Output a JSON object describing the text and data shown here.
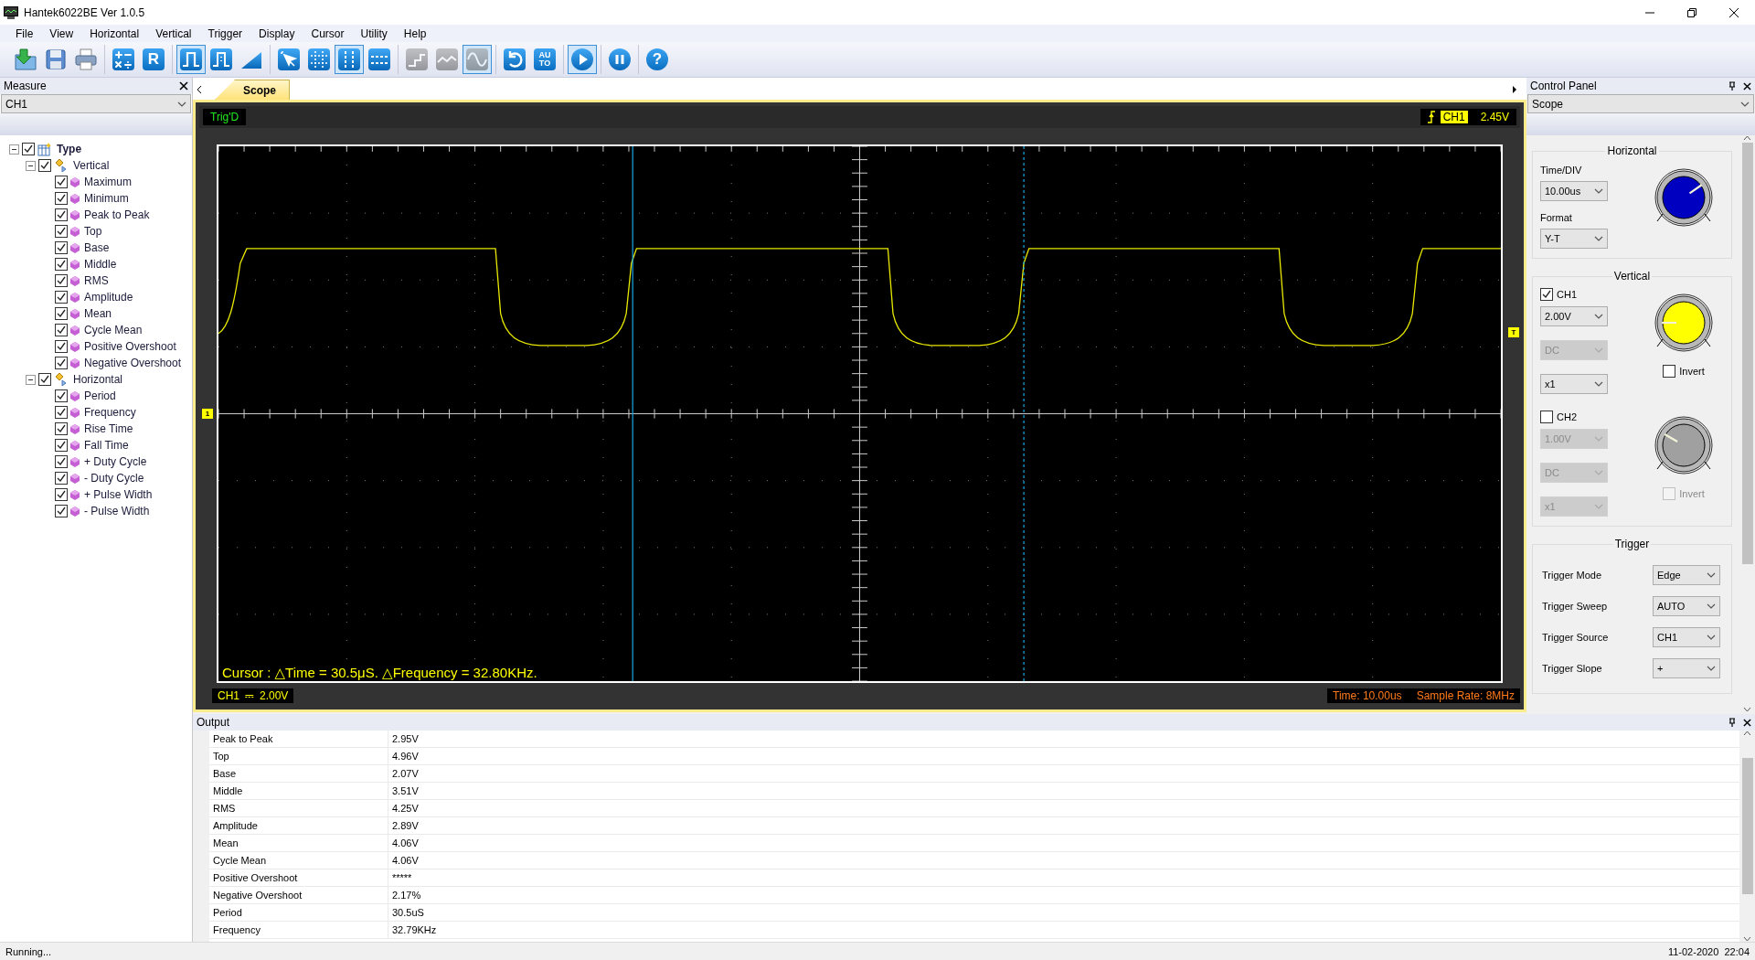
{
  "window": {
    "title": "Hantek6022BE Ver 1.0.5"
  },
  "menu": [
    "File",
    "View",
    "Horizontal",
    "Vertical",
    "Trigger",
    "Display",
    "Cursor",
    "Utility",
    "Help"
  ],
  "toolbar": [
    {
      "buttons": [
        {
          "pressed": false,
          "disabled": false
        },
        {
          "pressed": false,
          "disabled": false
        },
        {
          "pressed": false,
          "disabled": false
        }
      ]
    },
    {
      "buttons": [
        {
          "pressed": false,
          "disabled": false
        },
        {
          "pressed": false,
          "disabled": false,
          "label": "R"
        }
      ]
    },
    {
      "buttons": [
        {
          "pressed": true,
          "disabled": false
        },
        {
          "pressed": false,
          "disabled": false
        },
        {
          "pressed": false,
          "disabled": false
        }
      ]
    },
    {
      "buttons": [
        {
          "pressed": false,
          "disabled": false
        },
        {
          "pressed": false,
          "disabled": false
        },
        {
          "pressed": true,
          "disabled": false
        },
        {
          "pressed": false,
          "disabled": false
        }
      ]
    },
    {
      "buttons": [
        {
          "pressed": false,
          "disabled": true
        },
        {
          "pressed": false,
          "disabled": true
        },
        {
          "pressed": true,
          "disabled": true
        }
      ]
    },
    {
      "buttons": [
        {
          "pressed": false,
          "disabled": false
        },
        {
          "pressed": false,
          "disabled": false,
          "label": "AUTO"
        }
      ]
    },
    {
      "buttons": [
        {
          "pressed": true,
          "disabled": false
        }
      ]
    },
    {
      "buttons": [
        {
          "pressed": false,
          "disabled": false
        }
      ]
    },
    {
      "buttons": [
        {
          "pressed": false,
          "disabled": false,
          "label": "?"
        }
      ]
    }
  ],
  "measure_panel": {
    "title": "Measure",
    "channel": "CH1",
    "tree": [
      {
        "label": "Type",
        "checked": true,
        "expanded": true,
        "children": [
          {
            "label": "Vertical",
            "checked": true,
            "expanded": true,
            "children": [
              {
                "label": "Maximum",
                "checked": true
              },
              {
                "label": "Minimum",
                "checked": true
              },
              {
                "label": "Peak to Peak",
                "checked": true
              },
              {
                "label": "Top",
                "checked": true
              },
              {
                "label": "Base",
                "checked": true
              },
              {
                "label": "Middle",
                "checked": true
              },
              {
                "label": "RMS",
                "checked": true
              },
              {
                "label": "Amplitude",
                "checked": true
              },
              {
                "label": "Mean",
                "checked": true
              },
              {
                "label": "Cycle Mean",
                "checked": true
              },
              {
                "label": "Positive Overshoot",
                "checked": true
              },
              {
                "label": "Negative Overshoot",
                "checked": true
              }
            ]
          },
          {
            "label": "Horizontal",
            "checked": true,
            "expanded": true,
            "children": [
              {
                "label": "Period",
                "checked": true
              },
              {
                "label": "Frequency",
                "checked": true
              },
              {
                "label": "Rise Time",
                "checked": true
              },
              {
                "label": "Fall Time",
                "checked": true
              },
              {
                "label": "+ Duty Cycle",
                "checked": true
              },
              {
                "label": "- Duty Cycle",
                "checked": true
              },
              {
                "label": "+ Pulse Width",
                "checked": true
              },
              {
                "label": "- Pulse Width",
                "checked": true
              }
            ]
          }
        ]
      }
    ]
  },
  "tabs": [
    {
      "label": "Scope",
      "selected": true
    }
  ],
  "scope": {
    "status": "Trig'D",
    "trigger_channel": "CH1",
    "trigger_level": "2.45V",
    "ch1_marker": "1",
    "trigger_marker": "T",
    "cursor_readout": "Cursor : △Time = 30.5μS. △Frequency = 32.80KHz.",
    "channel_label": "CH1",
    "coupling_symbol": "⎓",
    "volts_div": "2.00V",
    "time_div": "Time: 10.00us",
    "sample_rate": "Sample Rate: 8MHz"
  },
  "control_panel": {
    "title": "Control Panel",
    "mode": "Scope",
    "horizontal": {
      "title": "Horizontal",
      "time_label": "Time/DIV",
      "time_div": "10.00us",
      "format_label": "Format",
      "format": "Y-T",
      "color": "#0000c0"
    },
    "vertical": {
      "title": "Vertical",
      "channels": [
        {
          "name": "CH1",
          "checked": true,
          "color": "#ffff00",
          "volts": {
            "value": "2.00V",
            "disabled": false
          },
          "coupling": {
            "value": "DC",
            "disabled": true
          },
          "probe": {
            "value": "x1",
            "disabled": false
          },
          "invert_label": "Invert",
          "inverted": false,
          "invert_disabled": false
        },
        {
          "name": "CH2",
          "checked": false,
          "color": "#a0a0a0",
          "volts": {
            "value": "1.00V",
            "disabled": true
          },
          "coupling": {
            "value": "DC",
            "disabled": true
          },
          "probe": {
            "value": "x1",
            "disabled": true
          },
          "invert_label": "Invert",
          "inverted": false,
          "invert_disabled": true
        }
      ]
    },
    "trigger": {
      "title": "Trigger",
      "rows": [
        {
          "label": "Trigger Mode",
          "value": "Edge"
        },
        {
          "label": "Trigger Sweep",
          "value": "AUTO"
        },
        {
          "label": "Trigger Source",
          "value": "CH1"
        },
        {
          "label": "Trigger Slope",
          "value": "+"
        }
      ]
    }
  },
  "output": {
    "title": "Output",
    "rows": [
      {
        "name": "Peak to Peak",
        "value": "2.95V"
      },
      {
        "name": "Top",
        "value": "4.96V"
      },
      {
        "name": "Base",
        "value": "2.07V"
      },
      {
        "name": "Middle",
        "value": "3.51V"
      },
      {
        "name": "RMS",
        "value": "4.25V"
      },
      {
        "name": "Amplitude",
        "value": "2.89V"
      },
      {
        "name": "Mean",
        "value": "4.06V"
      },
      {
        "name": "Cycle Mean",
        "value": "4.06V"
      },
      {
        "name": "Positive Overshoot",
        "value": "*****"
      },
      {
        "name": "Negative Overshoot",
        "value": "2.17%"
      },
      {
        "name": "Period",
        "value": "30.5uS"
      },
      {
        "name": "Frequency",
        "value": "32.79KHz"
      }
    ]
  },
  "status_bar": {
    "message": "Running...",
    "datetime": "11-02-2020  22:04"
  }
}
